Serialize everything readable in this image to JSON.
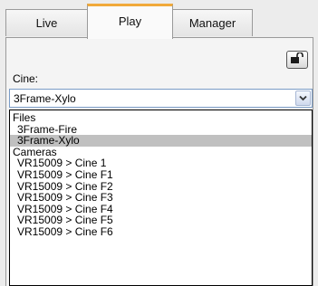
{
  "tabs": [
    {
      "label": "Live"
    },
    {
      "label": "Play"
    },
    {
      "label": "Manager"
    }
  ],
  "active_tab": "Play",
  "cine": {
    "label": "Cine:",
    "selected": "3Frame-Xylo"
  },
  "dropdown": {
    "files_header": "Files",
    "files": [
      {
        "label": "3Frame-Fire"
      },
      {
        "label": "3Frame-Xylo"
      }
    ],
    "cameras_header": "Cameras",
    "cameras": [
      {
        "label": "VR15009 > Cine 1"
      },
      {
        "label": "VR15009 > Cine F1"
      },
      {
        "label": "VR15009 > Cine F2"
      },
      {
        "label": "VR15009 > Cine F3"
      },
      {
        "label": "VR15009 > Cine F4"
      },
      {
        "label": "VR15009 > Cine F5"
      },
      {
        "label": "VR15009 > Cine F6"
      }
    ]
  },
  "icons": {
    "lock": "unlock-icon",
    "dropdown_arrow": "chevron-down-icon"
  },
  "colors": {
    "active_tab_accent": "#f1a93a",
    "selected_item_bg": "#c0c0c0"
  }
}
